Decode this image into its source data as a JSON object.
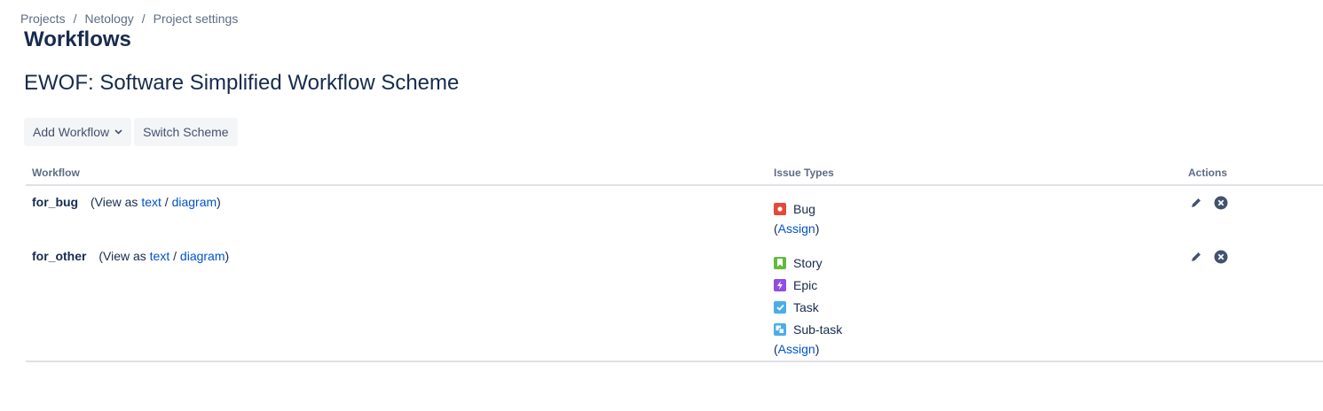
{
  "breadcrumb": [
    "Projects",
    "Netology",
    "Project settings"
  ],
  "page_title": "Workflows",
  "scheme_title": "EWOF: Software Simplified Workflow Scheme",
  "toolbar": {
    "add_workflow_label": "Add Workflow",
    "switch_scheme_label": "Switch Scheme"
  },
  "table": {
    "headers": {
      "workflow": "Workflow",
      "issue_types": "Issue Types",
      "actions": "Actions"
    },
    "view_as_prefix": "(View as",
    "text_link": "text",
    "slash": "/",
    "diagram_link": "diagram",
    "close_paren": ")",
    "assign_label": "Assign",
    "rows": [
      {
        "name": "for_bug",
        "issue_types": [
          {
            "label": "Bug",
            "icon": "bug-icon",
            "color": "#e5493a"
          }
        ]
      },
      {
        "name": "for_other",
        "issue_types": [
          {
            "label": "Story",
            "icon": "story-icon",
            "color": "#63ba3c"
          },
          {
            "label": "Epic",
            "icon": "epic-icon",
            "color": "#904ee2"
          },
          {
            "label": "Task",
            "icon": "task-icon",
            "color": "#4bade8"
          },
          {
            "label": "Sub-task",
            "icon": "subtask-icon",
            "color": "#4bade8"
          }
        ]
      }
    ]
  }
}
